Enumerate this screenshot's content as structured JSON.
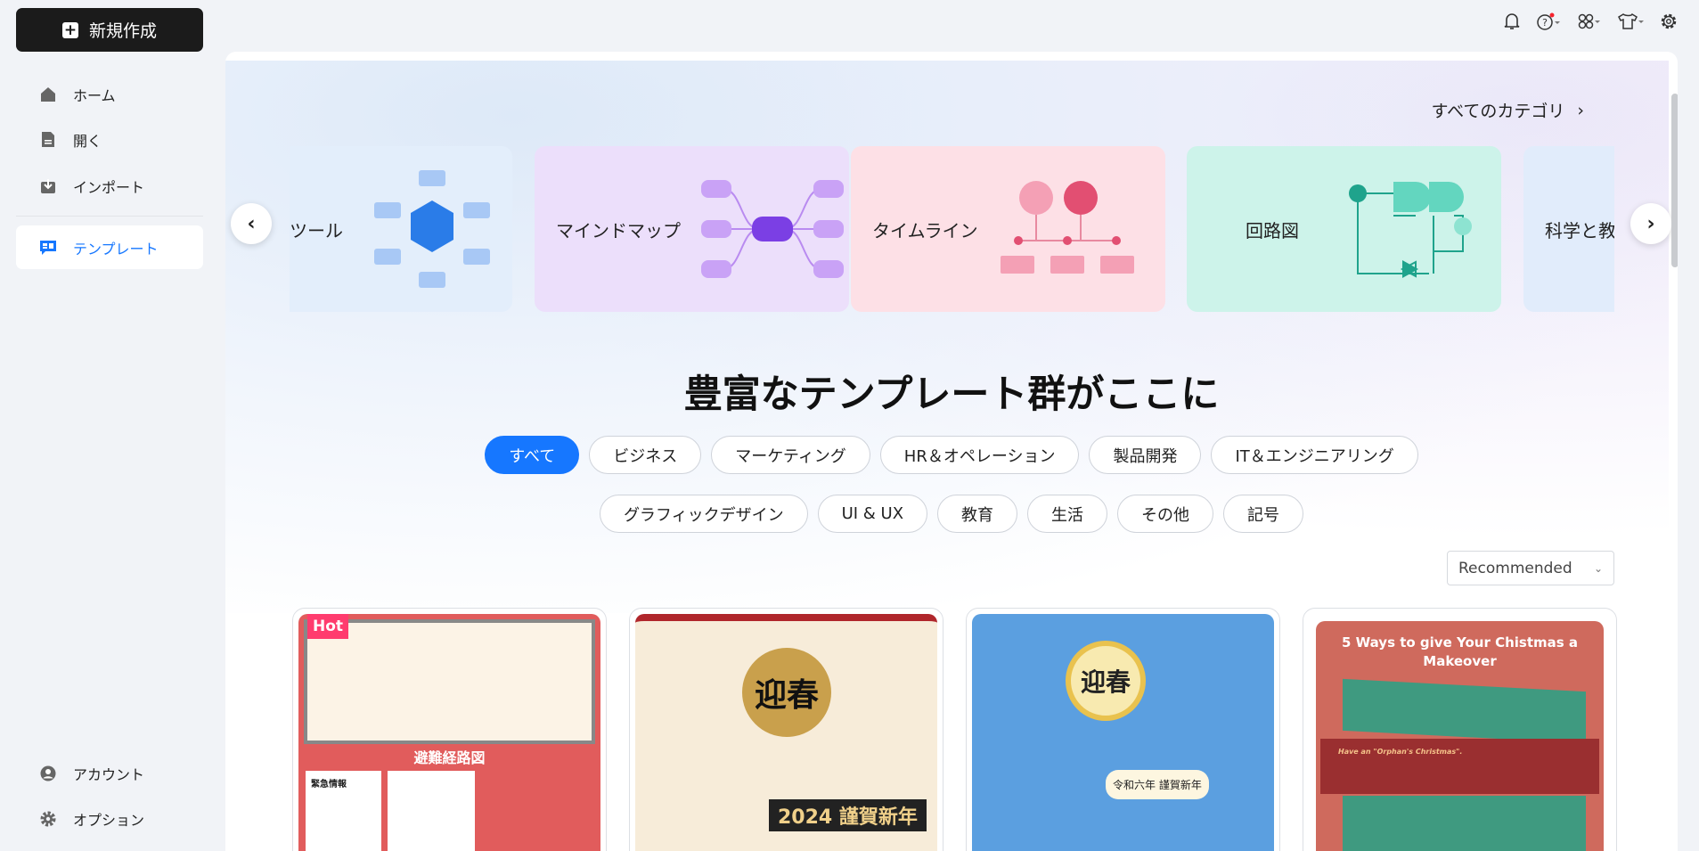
{
  "sidebar": {
    "new_button": "新規作成",
    "items": [
      {
        "label": "ホーム",
        "icon": "home-icon"
      },
      {
        "label": "開く",
        "icon": "file-icon"
      },
      {
        "label": "インポート",
        "icon": "import-icon"
      },
      {
        "label": "テンプレート",
        "icon": "template-icon",
        "active": true
      }
    ],
    "bottom": [
      {
        "label": "アカウント",
        "icon": "account-icon"
      },
      {
        "label": "オプション",
        "icon": "gear-icon"
      }
    ]
  },
  "topbar": {
    "icons": [
      "bell-icon",
      "help-icon",
      "apps-icon",
      "theme-shirt-icon",
      "settings-icon"
    ],
    "notification_dot_color": "#f5222d"
  },
  "hero": {
    "all_categories": "すべてのカテゴリ",
    "carousel": [
      {
        "label": "ツール",
        "color": "#e3eefb"
      },
      {
        "label": "マインドマップ",
        "color": "#ecdffb"
      },
      {
        "label": "タイムライン",
        "color": "#fde0e6"
      },
      {
        "label": "回路図",
        "color": "#cdf3ea"
      },
      {
        "label": "科学と教",
        "color": "#e1ecfb"
      }
    ],
    "title": "豊富なテンプレート群がここに"
  },
  "filters": {
    "row1": [
      "すべて",
      "ビジネス",
      "マーケティング",
      "HR＆オペレーション",
      "製品開発",
      "IT＆エンジニアリング"
    ],
    "row2": [
      "グラフィックデザイン",
      "UI & UX",
      "教育",
      "生活",
      "その他",
      "記号"
    ],
    "active": "すべて",
    "accent": "#1677ff"
  },
  "sort": {
    "selected": "Recommended"
  },
  "templates": [
    {
      "badge": "Hot",
      "title": "避難経路図",
      "subtitle": "緊急情報"
    },
    {
      "title": "迎春",
      "text": "2024 謹賀新年"
    },
    {
      "title": "迎春",
      "text": "令和六年 謹賀新年"
    },
    {
      "title": "5 Ways to give Your Chistmas a Makeover",
      "text": "Have an \"Orphan's Christmas\"."
    }
  ]
}
